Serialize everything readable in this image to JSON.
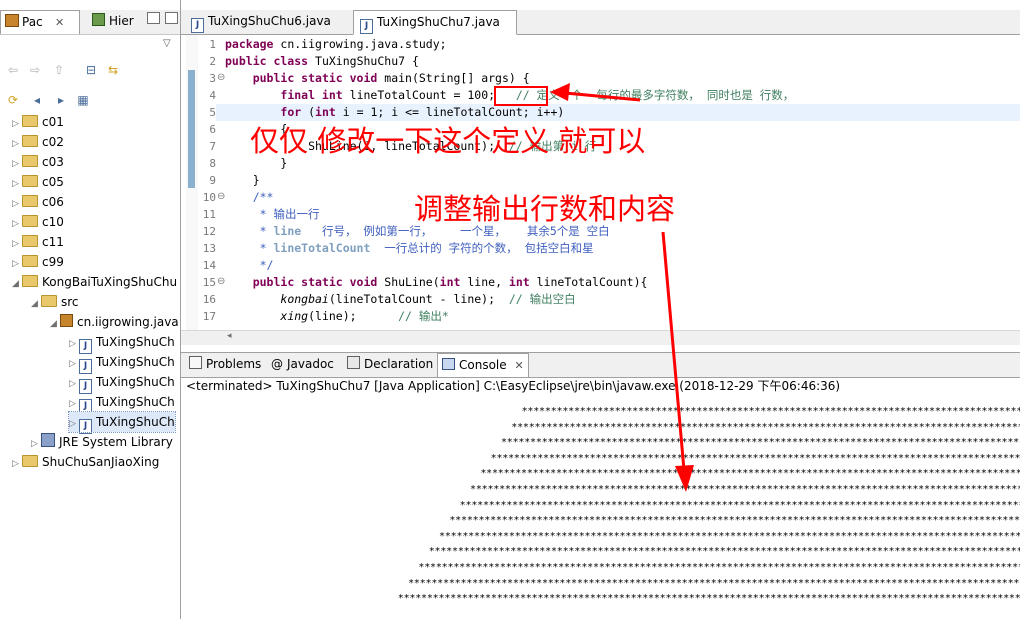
{
  "left_panel": {
    "tabs": [
      {
        "label": "Pac",
        "active": true,
        "close": "✕"
      },
      {
        "label": "Hier",
        "active": false
      }
    ],
    "tree": [
      {
        "label": "c01",
        "indent": 0,
        "type": "project"
      },
      {
        "label": "c02",
        "indent": 0,
        "type": "project"
      },
      {
        "label": "c03",
        "indent": 0,
        "type": "project"
      },
      {
        "label": "c05",
        "indent": 0,
        "type": "project"
      },
      {
        "label": "c06",
        "indent": 0,
        "type": "project"
      },
      {
        "label": "c10",
        "indent": 0,
        "type": "project"
      },
      {
        "label": "c11",
        "indent": 0,
        "type": "project"
      },
      {
        "label": "c99",
        "indent": 0,
        "type": "project"
      },
      {
        "label": "KongBaiTuXingShuChu",
        "indent": 0,
        "type": "project",
        "expanded": true
      },
      {
        "label": "src",
        "indent": 1,
        "type": "folder",
        "expanded": true
      },
      {
        "label": "cn.iigrowing.java",
        "indent": 2,
        "type": "package",
        "expanded": true
      },
      {
        "label": "TuXingShuCh",
        "indent": 3,
        "type": "java"
      },
      {
        "label": "TuXingShuCh",
        "indent": 3,
        "type": "java"
      },
      {
        "label": "TuXingShuCh",
        "indent": 3,
        "type": "java"
      },
      {
        "label": "TuXingShuCh",
        "indent": 3,
        "type": "java"
      },
      {
        "label": "TuXingShuCh",
        "indent": 3,
        "type": "java",
        "selected": true
      },
      {
        "label": "JRE System Library",
        "indent": 1,
        "type": "library"
      },
      {
        "label": "ShuChuSanJiaoXing",
        "indent": 0,
        "type": "project"
      }
    ]
  },
  "editor": {
    "tabs": [
      {
        "label": "TuXingShuChu6.java",
        "active": false
      },
      {
        "label": "TuXingShuChu7.java",
        "active": true,
        "close": "✕"
      }
    ],
    "lines": [
      {
        "n": "1",
        "segs": [
          [
            "kw",
            "package"
          ],
          [
            "",
            "cn.iigrowing.java.study;"
          ]
        ]
      },
      {
        "n": "2",
        "segs": [
          [
            "kw",
            "public class"
          ],
          [
            "",
            "TuXingShuChu7 {"
          ]
        ]
      },
      {
        "n": "3",
        "fold": true,
        "segs": [
          [
            "",
            "    "
          ],
          [
            "kw",
            "public static void"
          ],
          [
            "",
            "main(String[] args) {"
          ]
        ]
      },
      {
        "n": "4",
        "segs": [
          [
            "",
            "        "
          ],
          [
            "kw",
            "final int"
          ],
          [
            "",
            "lineTotalCount = 100;"
          ],
          [
            "cmt",
            "   // 定义一个  每行的最多字符数， 同时也是 行数，"
          ]
        ]
      },
      {
        "n": "5",
        "segs": [
          [
            "",
            "        "
          ],
          [
            "kw",
            "for"
          ],
          [
            "",
            "("
          ],
          [
            "kw",
            "int"
          ],
          [
            "",
            "i = 1; i <= lineTotalCount; i++)"
          ]
        ]
      },
      {
        "n": "6",
        "segs": [
          [
            "",
            "        {"
          ]
        ]
      },
      {
        "n": "7",
        "segs": [
          [
            "",
            "            ShuLine(i, lineTotalCount);"
          ],
          [
            "cmt",
            "  // 输出第 i 行"
          ]
        ]
      },
      {
        "n": "8",
        "segs": [
          [
            "",
            "        }"
          ]
        ]
      },
      {
        "n": "9",
        "segs": [
          [
            "",
            "    }"
          ]
        ]
      },
      {
        "n": "10",
        "fold": true,
        "segs": [
          [
            "jdoc",
            "    /**"
          ]
        ]
      },
      {
        "n": "11",
        "segs": [
          [
            "jdoc",
            "     * 输出一行"
          ]
        ]
      },
      {
        "n": "12",
        "segs": [
          [
            "jdoc",
            "     * "
          ],
          [
            "jdoc-tag",
            "line"
          ],
          [
            "jdoc",
            "   行号， 例如第一行，    一个星，   其余5个是 空白"
          ]
        ]
      },
      {
        "n": "13",
        "segs": [
          [
            "jdoc",
            "     * "
          ],
          [
            "jdoc-tag",
            "lineTotalCount"
          ],
          [
            "jdoc",
            "  一行总计的 字符的个数， 包括空白和星"
          ]
        ]
      },
      {
        "n": "14",
        "segs": [
          [
            "jdoc",
            "     */"
          ]
        ]
      },
      {
        "n": "15",
        "fold": true,
        "segs": [
          [
            "",
            "    "
          ],
          [
            "kw",
            "public static void"
          ],
          [
            "",
            "ShuLine("
          ],
          [
            "kw",
            "int"
          ],
          [
            "",
            "line, "
          ],
          [
            "kw",
            "int"
          ],
          [
            "",
            "lineTotalCount){"
          ]
        ]
      },
      {
        "n": "16",
        "segs": [
          [
            "",
            "        "
          ],
          [
            "italic",
            "kongbai"
          ],
          [
            "",
            "(lineTotalCount - line);"
          ],
          [
            "cmt",
            "  // 输出空白"
          ]
        ]
      },
      {
        "n": "17",
        "segs": [
          [
            "",
            "        "
          ],
          [
            "italic",
            "xing"
          ],
          [
            "",
            "(line);"
          ],
          [
            "cmt",
            "      // 输出*"
          ]
        ]
      }
    ]
  },
  "console": {
    "tabs": [
      {
        "label": "Problems",
        "active": false
      },
      {
        "label": "Javadoc",
        "active": false
      },
      {
        "label": "Declaration",
        "active": false
      },
      {
        "label": "Console",
        "active": true,
        "close": "✕"
      }
    ],
    "status": "<terminated> TuXingShuChu7 [Java Application] C:\\EasyEclipse\\jre\\bin\\javaw.exe (2018-12-29 下午06:46:36)",
    "output_lines": 13
  },
  "annotations": {
    "top": "仅仅 修改一下这个定义  就可以",
    "middle": "调整输出行数和内容"
  },
  "colors": {
    "annotation_red": "#ff0000",
    "keyword": "#7f0055",
    "comment": "#3f7f5f",
    "javadoc": "#3f5fbf"
  }
}
